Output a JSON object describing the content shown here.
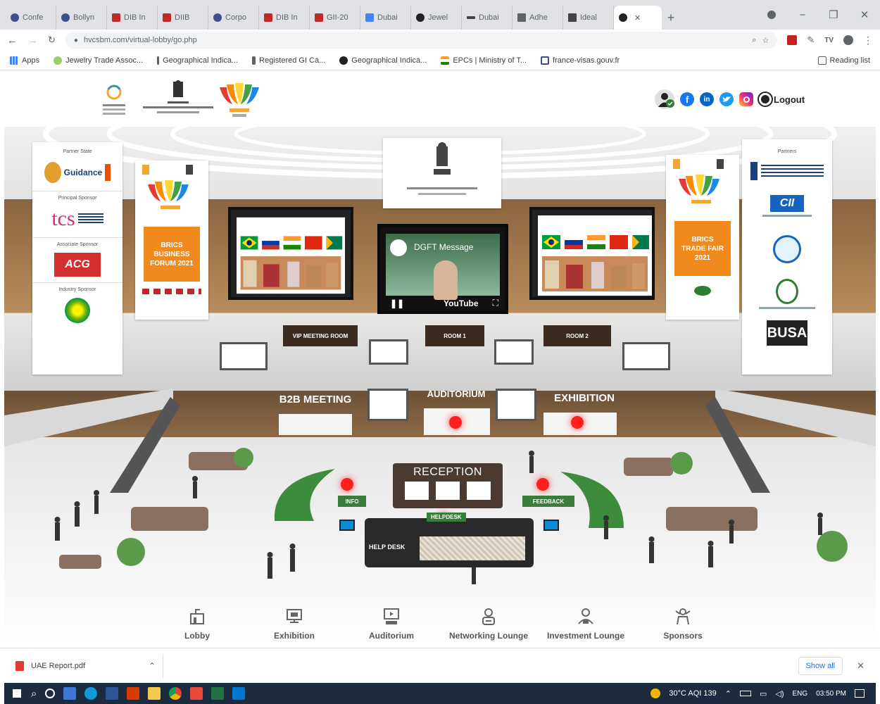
{
  "browser": {
    "tabs": [
      {
        "label": "Confe",
        "color": "#3c4f8f"
      },
      {
        "label": "Bollyn",
        "color": "#3c4f8f"
      },
      {
        "label": "DIB In",
        "color": "#c0282c"
      },
      {
        "label": "DIIB",
        "color": "#c0282c"
      },
      {
        "label": "Corpo",
        "color": "#3c4f8f"
      },
      {
        "label": "DIB In",
        "color": "#c0282c"
      },
      {
        "label": "GII-20",
        "color": "#c0282c"
      },
      {
        "label": "Dubai",
        "color": "#4285f4"
      },
      {
        "label": "Jewel",
        "color": "#202124"
      },
      {
        "label": "Dubai",
        "color": "#444"
      },
      {
        "label": "Adhe",
        "color": "#5f6368"
      },
      {
        "label": "Ideal",
        "color": "#444"
      },
      {
        "label": "",
        "color": "#202124"
      }
    ],
    "new_tab": "+",
    "url": "hvcsbm.com/virtual-lobby/go.php",
    "bookmarks": [
      {
        "label": "Apps",
        "color": "#4285f4"
      },
      {
        "label": "Jewelry Trade Assoc...",
        "color": "#9ccc65"
      },
      {
        "label": "Geographical Indica...",
        "color": "#5f6368"
      },
      {
        "label": "Registered GI Ca...",
        "color": "#5f6368"
      },
      {
        "label": "Geographical Indica...",
        "color": "#202124"
      },
      {
        "label": "EPCs | Ministry of T...",
        "color": "#ff9933"
      },
      {
        "label": "france-visas.gouv.fr",
        "color": "#3c4f8f"
      }
    ],
    "reading_list": "Reading list"
  },
  "header": {
    "logout": "Logout"
  },
  "scene": {
    "left_sign": {
      "partner_state": "Partner State",
      "partner_name": "Guidance",
      "principal_sponsor": "Principal Sponsor",
      "tcs": "tcs",
      "associate_sponsor": "Associate Sponsor",
      "acg": "ACG",
      "industry_sponsor": "Industry Sponsor"
    },
    "right_sign": {
      "partners": "Partners",
      "cii": "CII",
      "busa": "BUSA"
    },
    "left_banner": "BRICS BUSINESS FORUM 2021",
    "right_banner": "BRICS TRADE FAIR 2021",
    "center_screen": {
      "title": "DGFT Message",
      "youtube": "YouTube"
    },
    "room_labels": [
      "VIP MEETING ROOM",
      "ROOM 1",
      "ROOM 2"
    ],
    "hall_labels": [
      "B2B MEETING",
      "AUDITORIUM",
      "EXHIBITION"
    ],
    "reception": "RECEPTION",
    "helpdesk": "HELPDESK",
    "help_desk": "HELP DESK",
    "info": "INFO",
    "feedback": "FEEDBACK"
  },
  "nav": [
    {
      "label": "Lobby"
    },
    {
      "label": "Exhibition"
    },
    {
      "label": "Auditorium"
    },
    {
      "label": "Networking Lounge"
    },
    {
      "label": "Investment Lounge"
    },
    {
      "label": "Sponsors"
    }
  ],
  "download": {
    "file": "UAE Report.pdf",
    "show_all": "Show all"
  },
  "taskbar": {
    "weather": "30°C AQI 139",
    "lang": "ENG",
    "time": "03:50 PM"
  }
}
